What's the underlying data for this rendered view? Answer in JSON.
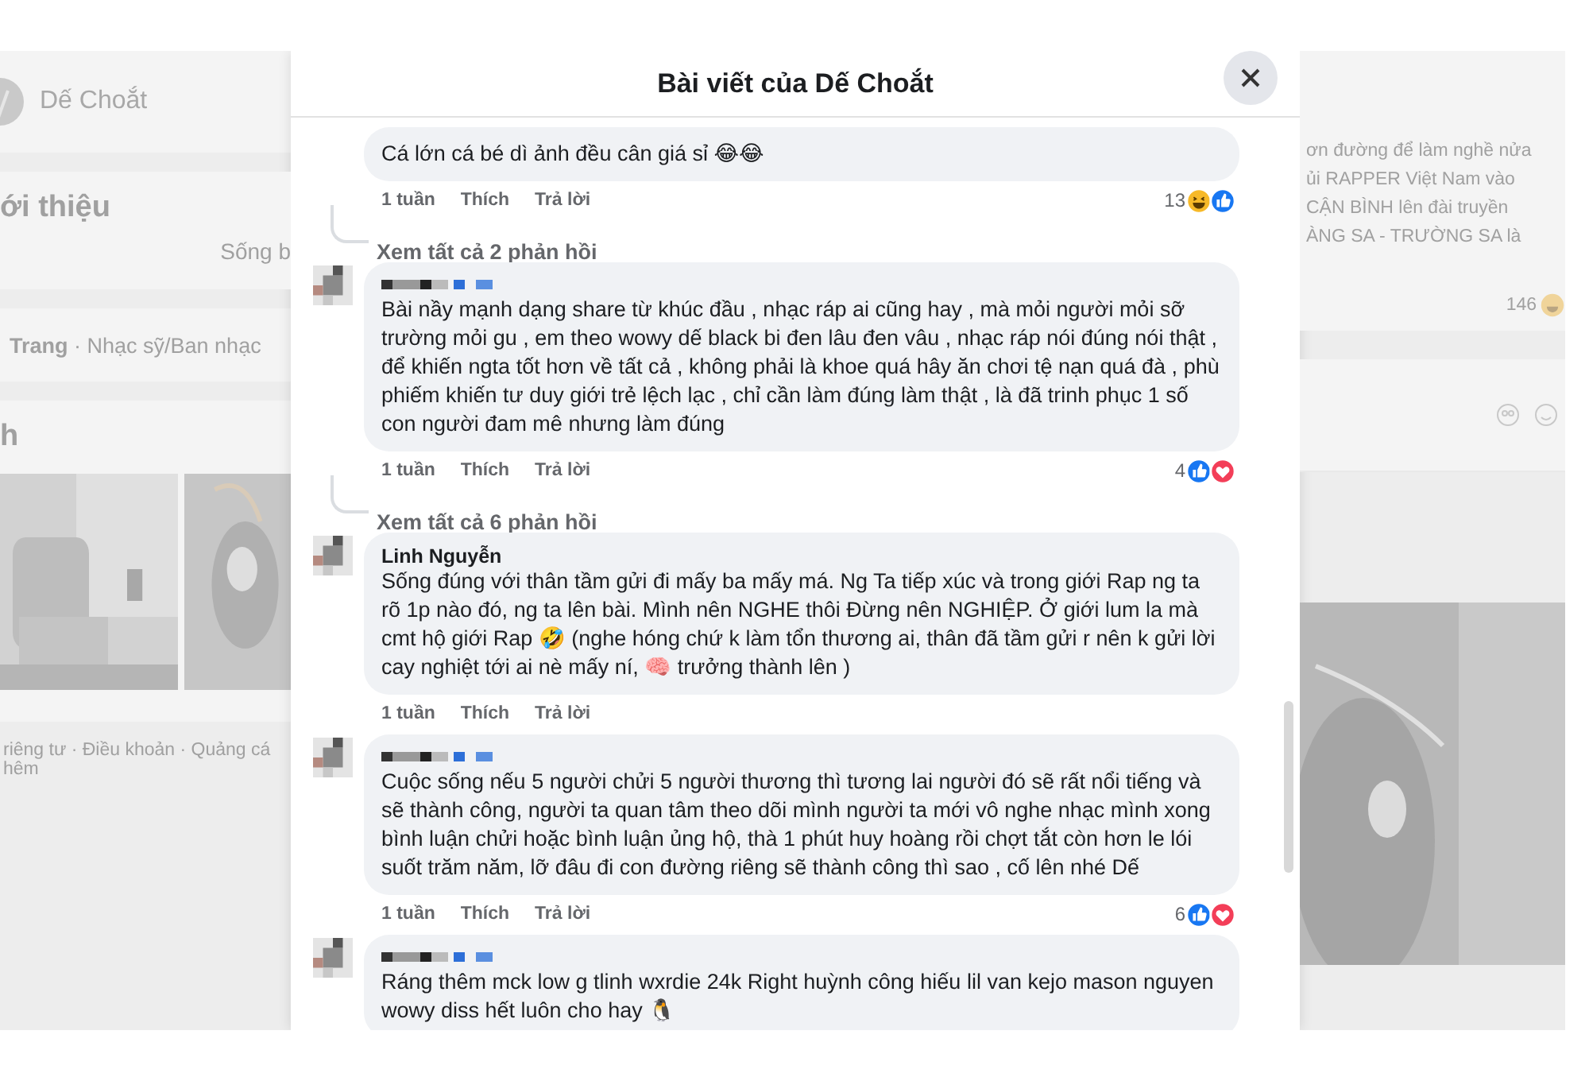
{
  "background": {
    "left": {
      "page_name": "Dế Choắt",
      "intro_title": "ới thiệu",
      "intro_text": "Sống b",
      "category_strong": "Trang",
      "category": " · Nhạc sỹ/Ban nhạc",
      "photos_title": "h",
      "footer_lines": [
        "riêng tư · Điều khoản · Quảng cá",
        "hêm"
      ]
    },
    "right": {
      "post_lines": [
        "ơn đường để làm nghề nửa",
        "ủi RAPPER Việt Nam vào",
        "CẬN BÌNH lên đài truyền",
        "ÀNG SA - TRƯỜNG SA là"
      ],
      "reaction_count": "146"
    }
  },
  "modal": {
    "title": "Bài viết của Dế Choắt",
    "comments": [
      {
        "text": "Cá lớn cá bé dì ảnh đều cân giá sỉ 😂😂",
        "time": "1 tuần",
        "like": "Thích",
        "reply": "Trả lời",
        "reaction_count": "13",
        "reactions": [
          {
            "kind": "haha"
          },
          {
            "kind": "like"
          }
        ],
        "replies_link": "Xem tất cả 2 phản hồi"
      },
      {
        "name_hidden": true,
        "text": "Bài nầy mạnh dạng share từ khúc đầu , nhạc ráp ai cũng hay , mà mỏi người mỏi sỡ trường mỏi gu , em theo wowy dế black bi đen lâu đen vâu , nhạc ráp nói đúng nói thật , để khiến ngta tốt hơn về tất cả , không phải là khoe quá hây ăn chơi tệ nạn quá đà , phù phiếm khiến tư duy giới trẻ lệch lạc , chỉ cần làm đúng làm thật , là đã trinh phục 1 số con người đam mê nhưng làm đúng",
        "time": "1 tuần",
        "like": "Thích",
        "reply": "Trả lời",
        "reaction_count": "4",
        "reactions": [
          {
            "kind": "like"
          },
          {
            "kind": "love"
          }
        ],
        "replies_link": "Xem tất cả 6 phản hồi"
      },
      {
        "name_hidden": false,
        "author": "Linh Nguyễn",
        "text": "Sống đúng với thân tầm gửi đi mấy ba mấy má. Ng Ta tiếp xúc và trong giới Rap ng ta rõ 1p nào đó, ng ta lên bài. Mình nên NGHE thôi Đừng nên NGHIỆP. Ở giới lum la mà cmt hộ giới Rap 🤣 (nghe hóng chứ k làm tổn thương ai, thân đã tầm gửi r nên k gửi lời cay nghiệt tới ai nè mấy ní, 🧠 trưởng thành lên )",
        "time": "1 tuần",
        "like": "Thích",
        "reply": "Trả lời"
      },
      {
        "name_hidden": true,
        "text": "Cuộc sống nếu 5 người chửi 5 người thương thì tương lai người đó sẽ rất nổi tiếng và sẽ thành công, người ta quan tâm theo dõi mình người ta mới vô nghe nhạc mình xong bình luận chửi hoặc bình luận ủng hộ, thà 1 phút huy hoàng rồi chợt tắt còn hơn le lói suốt trăm năm, lỡ đâu đi con đường riêng sẽ thành công thì sao , cố lên nhé Dế",
        "time": "1 tuần",
        "like": "Thích",
        "reply": "Trả lời",
        "reaction_count": "6",
        "reactions": [
          {
            "kind": "like"
          },
          {
            "kind": "love"
          }
        ]
      },
      {
        "name_hidden": true,
        "text": "Ráng thêm mck low g tlinh wxrdie 24k Right huỳnh công hiếu lil van kejo mason nguyen wowy diss hết luôn cho hay 🐧"
      }
    ]
  }
}
